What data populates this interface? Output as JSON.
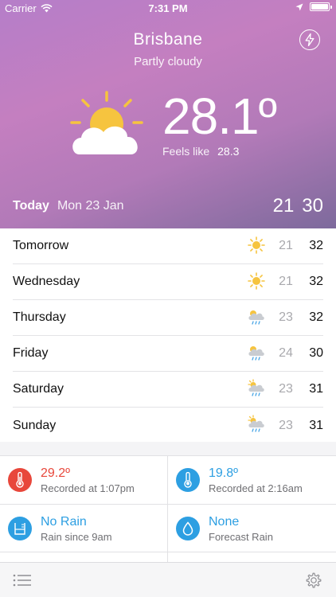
{
  "status": {
    "carrier": "Carrier",
    "time": "7:31 PM"
  },
  "header": {
    "city": "Brisbane",
    "condition": "Partly cloudy",
    "temp": "28.1º",
    "feels_label": "Feels like",
    "feels_value": "28.3"
  },
  "today": {
    "label": "Today",
    "date": "Mon 23 Jan",
    "min": "21",
    "max": "30"
  },
  "forecast": [
    {
      "day": "Tomorrow",
      "icon": "sun-icon",
      "min": "21",
      "max": "32"
    },
    {
      "day": "Wednesday",
      "icon": "sun-icon",
      "min": "21",
      "max": "32"
    },
    {
      "day": "Thursday",
      "icon": "cloud-rain-icon",
      "min": "23",
      "max": "32"
    },
    {
      "day": "Friday",
      "icon": "cloud-rain-icon",
      "min": "24",
      "max": "30"
    },
    {
      "day": "Saturday",
      "icon": "sun-cloud-rain-icon",
      "min": "23",
      "max": "31"
    },
    {
      "day": "Sunday",
      "icon": "sun-cloud-rain-icon",
      "min": "23",
      "max": "31"
    }
  ],
  "stats": {
    "max_temp": {
      "value": "29.2º",
      "sub": "Recorded at 1:07pm",
      "color": "#e8473b"
    },
    "min_temp": {
      "value": "19.8º",
      "sub": "Recorded at 2:16am",
      "color": "#2d9fe2"
    },
    "rain": {
      "value": "No Rain",
      "sub": "Rain since 9am",
      "color": "#2d9fe2"
    },
    "forecast_rain": {
      "value": "None",
      "sub": "Forecast Rain",
      "color": "#2d9fe2"
    }
  },
  "colors": {
    "accent": "#2d9fe2",
    "hot": "#e8473b",
    "sun": "#f6c43f"
  }
}
